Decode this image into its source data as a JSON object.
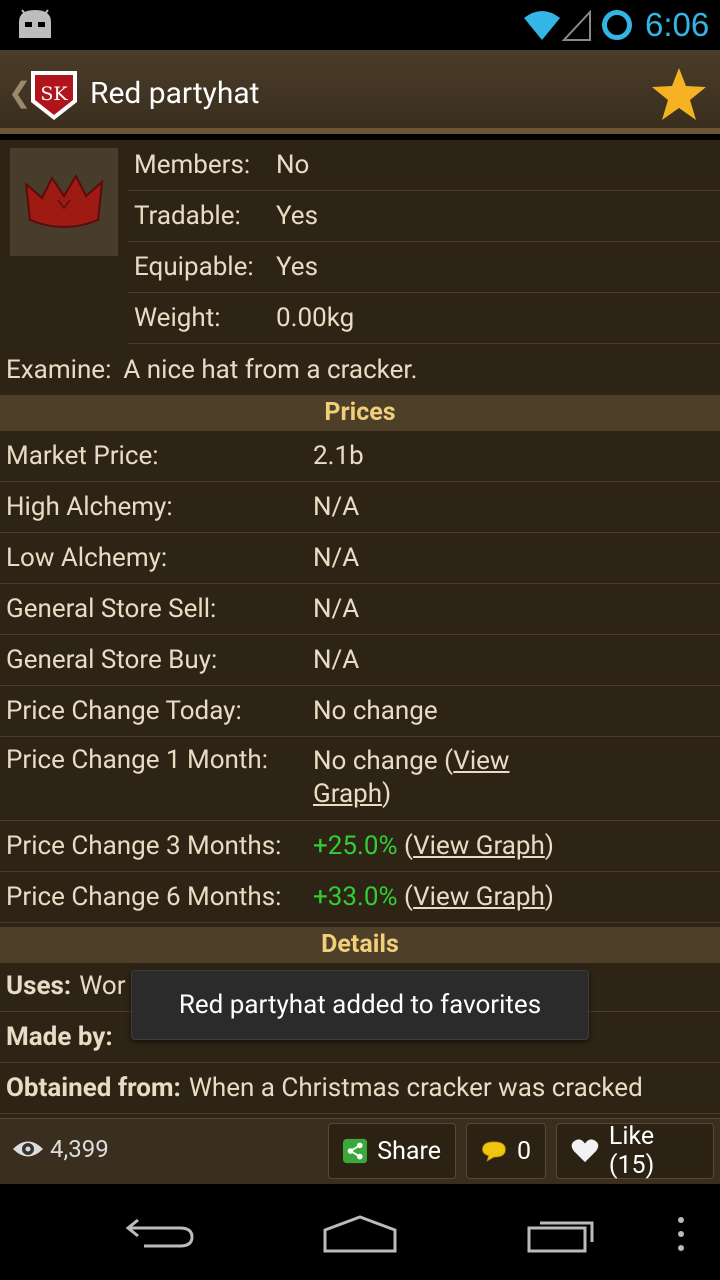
{
  "status_bar": {
    "time": "6:06"
  },
  "action_bar": {
    "title": "Red partyhat",
    "back_glyph": "❮",
    "logo_text": "SK"
  },
  "item": {
    "properties": [
      {
        "label": "Members:",
        "value": "No"
      },
      {
        "label": "Tradable:",
        "value": "Yes"
      },
      {
        "label": "Equipable:",
        "value": "Yes"
      },
      {
        "label": "Weight:",
        "value": "0.00kg"
      }
    ],
    "examine_label": "Examine:",
    "examine_text": "A nice hat from a cracker."
  },
  "prices": {
    "heading": "Prices",
    "market_price": {
      "label": "Market Price:",
      "value": "2.1b"
    },
    "high_alchemy": {
      "label": "High Alchemy:",
      "value": "N/A"
    },
    "low_alchemy": {
      "label": "Low Alchemy:",
      "value": "N/A"
    },
    "store_sell": {
      "label": "General Store Sell:",
      "value": "N/A"
    },
    "store_buy": {
      "label": "General Store Buy:",
      "value": "N/A"
    },
    "change_today": {
      "label": "Price Change Today:",
      "value": "No change"
    },
    "change_1m": {
      "label": "Price Change 1 Month:",
      "value": "No change",
      "link": "View Graph"
    },
    "change_3m": {
      "label": "Price Change 3 Months:",
      "value": "+25.0%",
      "link": "View Graph"
    },
    "change_6m": {
      "label": "Price Change 6 Months:",
      "value": "+33.0%",
      "link": "View Graph"
    }
  },
  "details": {
    "heading": "Details",
    "uses_label": "Uses:",
    "uses_value": "Wor",
    "made_by_label": "Made by:",
    "obtained_label": "Obtained from:",
    "obtained_value": "When a Christmas cracker was cracked"
  },
  "toast": {
    "text": "Red partyhat added to favorites"
  },
  "bottom_bar": {
    "views": "4,399",
    "share_label": "Share",
    "comments": "0",
    "like_label": "Like (15)"
  },
  "colors": {
    "accent": "#33b5e5",
    "heading": "#f1cf7a",
    "positive": "#33cc33",
    "background": "#2e2416"
  }
}
